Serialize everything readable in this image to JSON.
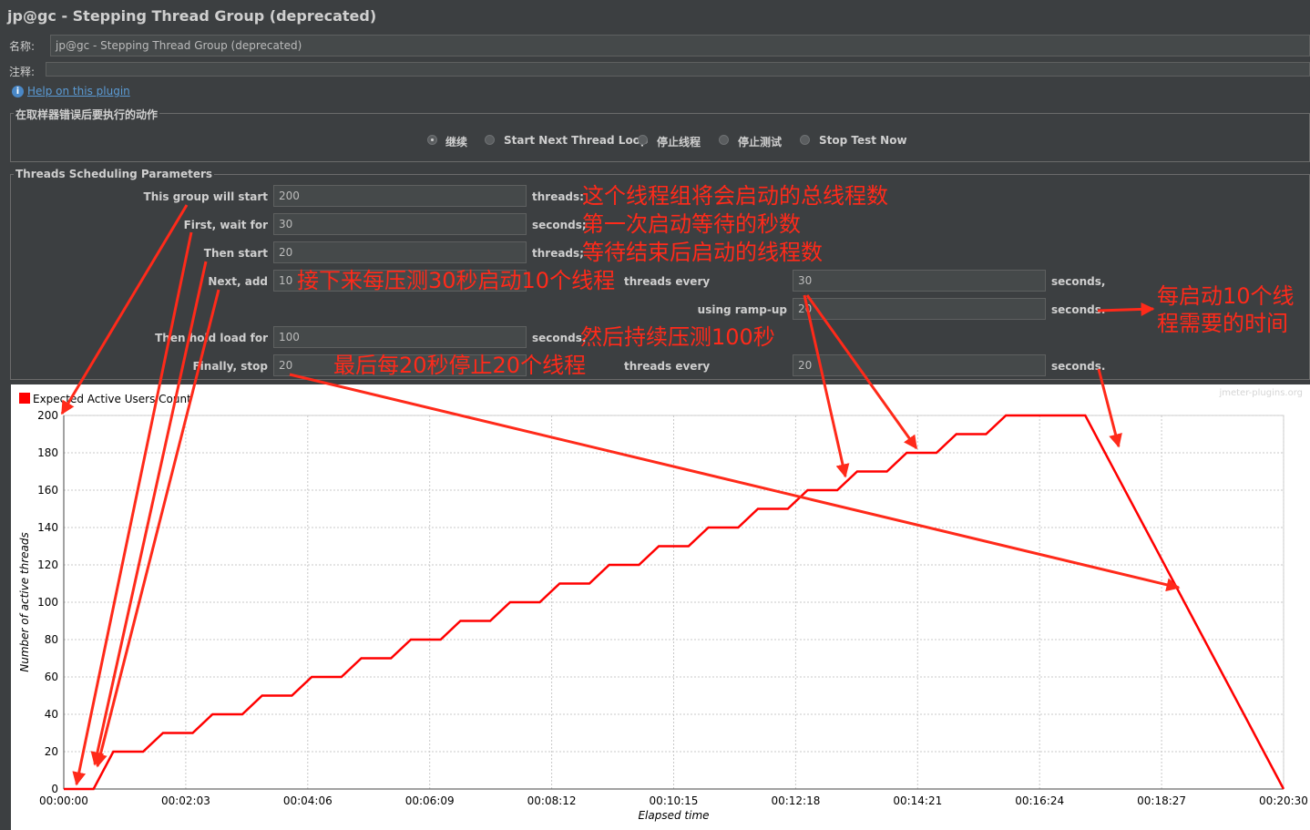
{
  "window": {
    "title": "jp@gc - Stepping Thread Group (deprecated)"
  },
  "name_field": {
    "label": "名称:",
    "value": "jp@gc - Stepping Thread Group (deprecated)"
  },
  "comment_field": {
    "label": "注释:",
    "value": ""
  },
  "help_link": "Help on this plugin",
  "error_action": {
    "legend": "在取样器错误后要执行的动作",
    "options": [
      {
        "label": "继续",
        "selected": true
      },
      {
        "label": "Start Next Thread Loop",
        "selected": false
      },
      {
        "label": "停止线程",
        "selected": false
      },
      {
        "label": "停止测试",
        "selected": false
      },
      {
        "label": "Stop Test Now",
        "selected": false
      }
    ]
  },
  "params": {
    "legend": "Threads Scheduling Parameters",
    "this_group_label": "This group will start",
    "this_group_value": "200",
    "this_group_unit": "threads:",
    "first_wait_label": "First, wait for",
    "first_wait_value": "30",
    "first_wait_unit": "seconds;",
    "then_start_label": "Then start",
    "then_start_value": "20",
    "then_start_unit": "threads;",
    "next_add_label": "Next, add",
    "next_add_value": "10",
    "next_add_mid": "threads every",
    "next_add_every_value": "30",
    "next_add_unit": "seconds,",
    "ramp_label": "using ramp-up",
    "ramp_value": "20",
    "ramp_unit": "seconds.",
    "hold_label": "Then hold load for",
    "hold_value": "100",
    "hold_unit": "seconds.",
    "stop_label": "Finally, stop",
    "stop_value": "20",
    "stop_mid": "threads every",
    "stop_every_value": "20",
    "stop_unit": "seconds."
  },
  "annotations": {
    "total_threads": "这个线程组将会启动的总线程数",
    "first_wait": "第一次启动等待的秒数",
    "then_start": "等待结束后启动的线程数",
    "next_add": "接下来每压测30秒启动10个线程",
    "ramp_up_line1": "每启动10个线",
    "ramp_up_line2": "程需要的时间",
    "hold": "然后持续压测100秒",
    "stop": "最后每20秒停止20个线程"
  },
  "colors": {
    "annotation": "#ff2a1a",
    "series": "#ff0000",
    "background": "#3c3f41"
  },
  "chart_data": {
    "type": "line",
    "watermark": "jmeter-plugins.org",
    "xlabel": "Elapsed time",
    "ylabel": "Number of active threads",
    "xlim": [
      0,
      1230
    ],
    "ylim": [
      0,
      200
    ],
    "x_ticks": [
      "00:00:00",
      "00:02:03",
      "00:04:06",
      "00:06:09",
      "00:08:12",
      "00:10:15",
      "00:12:18",
      "00:14:21",
      "00:16:24",
      "00:18:27",
      "00:20:30"
    ],
    "y_ticks": [
      "0",
      "20",
      "40",
      "60",
      "80",
      "100",
      "120",
      "140",
      "160",
      "180",
      "200"
    ],
    "grid": true,
    "legend_position": "top-left",
    "series": [
      {
        "name": "Expected Active Users Count",
        "x": [
          0,
          30,
          50,
          80,
          100,
          130,
          150,
          180,
          200,
          230,
          250,
          280,
          300,
          330,
          350,
          380,
          400,
          430,
          450,
          480,
          500,
          530,
          550,
          580,
          600,
          630,
          650,
          680,
          700,
          730,
          750,
          780,
          800,
          830,
          850,
          880,
          900,
          930,
          950,
          980,
          1030,
          1050,
          1070,
          1090,
          1110,
          1130,
          1150,
          1170,
          1190,
          1210,
          1230
        ],
        "y": [
          0,
          0,
          20,
          20,
          30,
          30,
          40,
          40,
          50,
          50,
          60,
          60,
          70,
          70,
          80,
          80,
          90,
          90,
          100,
          100,
          110,
          110,
          120,
          120,
          130,
          130,
          140,
          140,
          150,
          150,
          160,
          160,
          170,
          170,
          180,
          180,
          190,
          190,
          200,
          200,
          200,
          180,
          160,
          140,
          120,
          100,
          80,
          60,
          40,
          20,
          0
        ]
      }
    ]
  }
}
